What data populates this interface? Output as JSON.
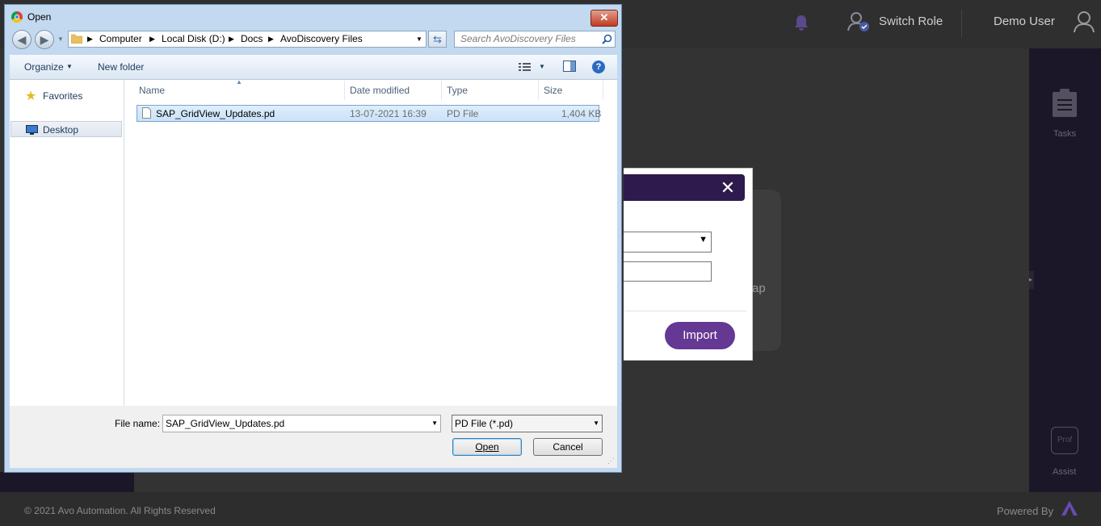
{
  "app": {
    "switch_role": "Switch Role",
    "user": "Demo User",
    "tasks_label": "Tasks",
    "assist_label": "Assist",
    "bg_partial_text": "ap",
    "footer_copyright": "© 2021 Avo Automation. All Rights Reserved",
    "footer_powered": "Powered By"
  },
  "import_modal": {
    "import_button": "Import",
    "close_glyph": "✕"
  },
  "dialog": {
    "title": "Open",
    "close_glyph": "✕",
    "breadcrumbs": [
      "Computer",
      "Local Disk (D:)",
      "Docs",
      "AvoDiscovery Files"
    ],
    "search_placeholder": "Search AvoDiscovery Files",
    "toolbar": {
      "organize": "Organize",
      "new_folder": "New folder"
    },
    "nav": {
      "favorites": "Favorites",
      "desktop": "Desktop"
    },
    "columns": [
      "Name",
      "Date modified",
      "Type",
      "Size"
    ],
    "files": [
      {
        "name": "SAP_GridView_Updates.pd",
        "date": "13-07-2021 16:39",
        "type": "PD File",
        "size": "1,404 KB"
      }
    ],
    "file_name_label": "File name:",
    "file_name_value": "SAP_GridView_Updates.pd",
    "file_type_value": "PD File (*.pd)",
    "open_button": "Open",
    "cancel_button": "Cancel"
  }
}
